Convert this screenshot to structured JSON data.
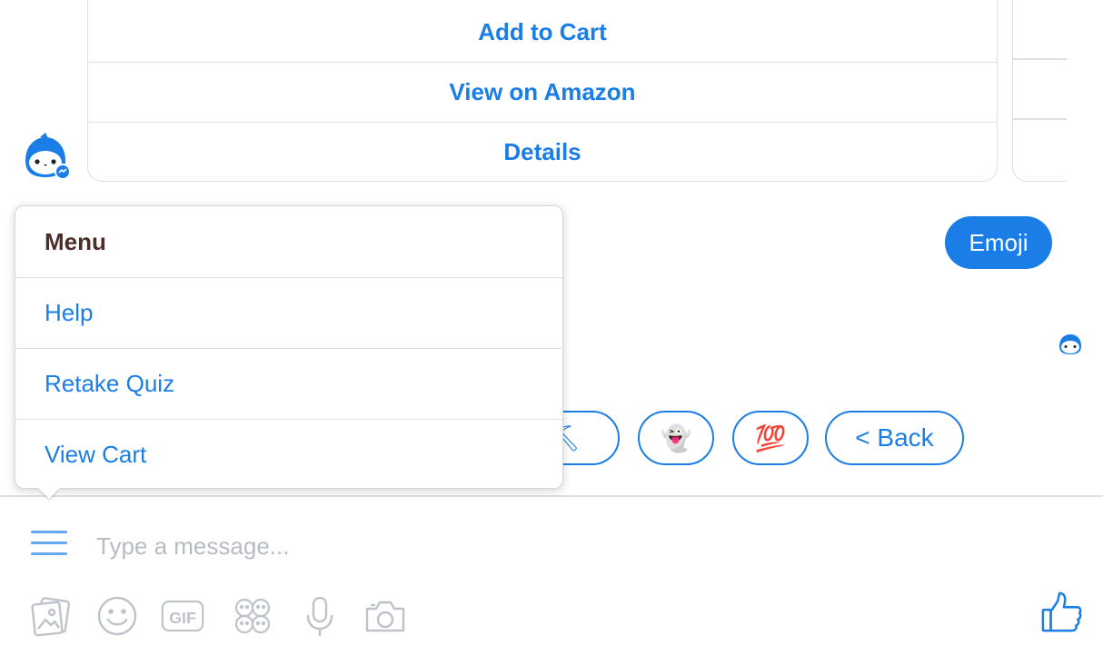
{
  "card": {
    "buttons": [
      "Add to Cart",
      "View on Amazon",
      "Details"
    ]
  },
  "messages": {
    "user_bubble": "Emoji"
  },
  "quick_replies": [
    "⛏",
    "👻",
    "💯",
    "< Back"
  ],
  "menu": {
    "title": "Menu",
    "items": [
      "Help",
      "Retake Quiz",
      "View Cart"
    ]
  },
  "composer": {
    "placeholder": "Type a message...",
    "tools": [
      "image-icon",
      "emoji-icon",
      "gif-icon",
      "stickers-icon",
      "microphone-icon",
      "camera-icon"
    ],
    "gif_label": "GIF",
    "like_icon": "thumbs-up-icon"
  },
  "colors": {
    "accent": "#1a7ee6",
    "menu_title": "#4b2e2a",
    "border": "#dddfe2",
    "icon_gray": "#bec2c9"
  }
}
